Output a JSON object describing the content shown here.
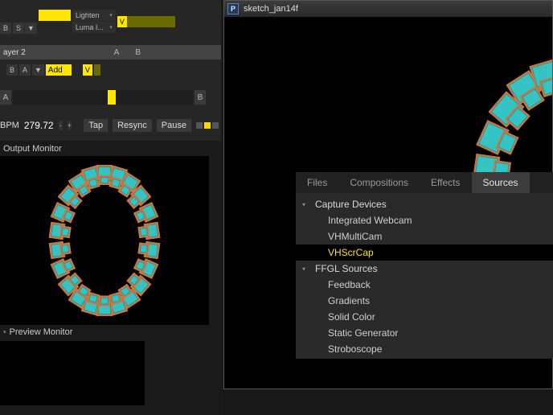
{
  "deck": {
    "layer_row_a": {
      "btn_b": "B",
      "btn_s": "S",
      "tri": "▼",
      "blend_top": "Lighten",
      "blend_bottom": "Luma I...",
      "v_label": "V"
    },
    "layer_name": "ayer 2",
    "ab_labels": {
      "a": "A",
      "b": "B"
    },
    "layer_row_b": {
      "btn_b": "B",
      "btn_a": "A",
      "tri": "▼",
      "add_label": "Add",
      "v_label": "V"
    }
  },
  "crossfader": {
    "left": "A",
    "right": "B"
  },
  "bpm": {
    "label": "BPM",
    "value": "279.72",
    "minus": "-",
    "plus": "+",
    "tap": "Tap",
    "resync": "Resync",
    "pause": "Pause"
  },
  "panels": {
    "output_monitor": "Output Monitor",
    "preview_monitor": "Preview Monitor"
  },
  "preview_window": {
    "title": "sketch_jan14f"
  },
  "sources_panel": {
    "tabs": {
      "files": "Files",
      "compositions": "Compositions",
      "effects": "Effects",
      "sources": "Sources"
    },
    "groups": [
      {
        "name": "Capture Devices",
        "items": [
          "Integrated Webcam",
          "VHMultiCam",
          "VHScrCap"
        ],
        "selected_index": 2
      },
      {
        "name": "FFGL Sources",
        "items": [
          "Feedback",
          "Gradients",
          "Solid Color",
          "Static Generator",
          "Stroboscope"
        ]
      }
    ]
  }
}
